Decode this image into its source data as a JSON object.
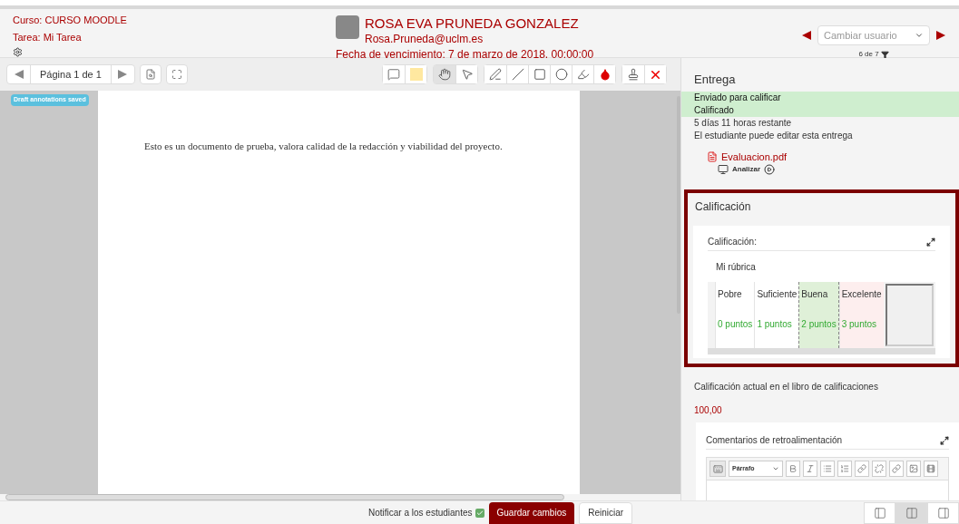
{
  "course": {
    "course_label": "Curso: CURSO MOODLE",
    "task_label": "Tarea: Mi Tarea"
  },
  "user": {
    "name": "ROSA EVA PRUNEDA GONZALEZ",
    "email": "Rosa.Pruneda@uclm.es",
    "due_date": "Fecha de vencimiento: 7 de marzo de 2018, 00:00:00"
  },
  "user_switcher": {
    "placeholder": "Cambiar usuario",
    "count": "6 de 7"
  },
  "pager": {
    "label": "Página 1 de 1"
  },
  "tool_groups": [
    [
      {
        "kind": "comment",
        "selected": false
      },
      {
        "kind": "color",
        "selected": false
      }
    ],
    [
      {
        "kind": "hand",
        "selected": true
      },
      {
        "kind": "pointer",
        "selected": false
      }
    ],
    [
      {
        "kind": "pen",
        "selected": false
      },
      {
        "kind": "line",
        "selected": false
      },
      {
        "kind": "rectangle",
        "selected": false
      },
      {
        "kind": "oval",
        "selected": false
      },
      {
        "kind": "highlighter",
        "selected": false
      },
      {
        "kind": "ink",
        "selected": false
      }
    ],
    [
      {
        "kind": "stamp",
        "selected": false
      },
      {
        "kind": "delete",
        "selected": false
      }
    ]
  ],
  "status_badge": "Draft annotations saved",
  "document": {
    "text": "Esto es un documento de prueba, valora calidad de la redacción y viabilidad del proyecto."
  },
  "submission": {
    "title": "Entrega",
    "statuses": [
      {
        "text": "Enviado para calificar",
        "highlighted": true
      },
      {
        "text": "Calificado",
        "highlighted": true
      },
      {
        "text": "5 días 11 horas restante",
        "highlighted": false
      },
      {
        "text": "El estudiante puede editar esta entrega",
        "highlighted": false
      }
    ],
    "file": {
      "name": "Evaluacion.pdf",
      "action": "Analizar"
    }
  },
  "grading": {
    "title": "Calificación",
    "field_label": "Calificación:",
    "rubric_name": "Mi rúbrica",
    "levels": [
      {
        "name": "Pobre",
        "points": "0 puntos",
        "selected": false,
        "hovered": false
      },
      {
        "name": "Suficiente",
        "points": "1 puntos",
        "selected": false,
        "hovered": false
      },
      {
        "name": "Buena",
        "points": "2 puntos",
        "selected": true,
        "hovered": false
      },
      {
        "name": "Excelente",
        "points": "3 puntos",
        "selected": false,
        "hovered": true
      }
    ]
  },
  "gradebook": {
    "label": "Calificación actual en el libro de calificaciones",
    "value": "100,00"
  },
  "feedback": {
    "title": "Comentarios de retroalimentación",
    "format": "Párrafo"
  },
  "footer": {
    "notify_label": "Notificar a los estudiantes",
    "notify_checked": true,
    "save": "Guardar cambios",
    "reset": "Reiniciar"
  },
  "layouts": [
    {
      "kind": "left",
      "selected": false
    },
    {
      "kind": "both",
      "selected": true
    },
    {
      "kind": "right",
      "selected": false
    }
  ]
}
